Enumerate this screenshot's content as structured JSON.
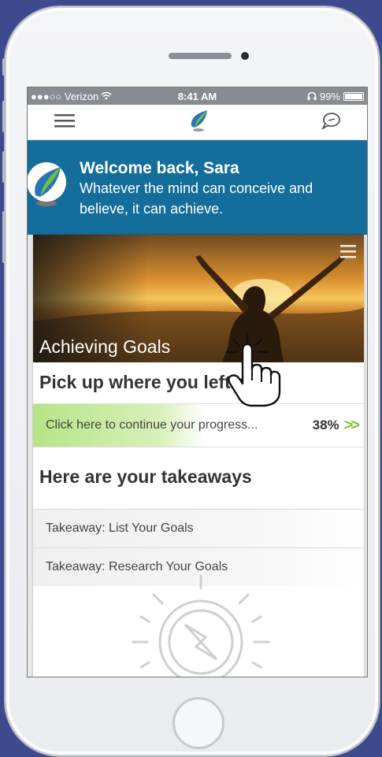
{
  "status": {
    "carrier": "●●●○○ Verizon",
    "time": "8:41 AM",
    "battery": "99%",
    "battery_level": 0.99
  },
  "navbar": {
    "menu_icon": "hamburger-menu-icon",
    "logo_icon": "app-leaf-logo-icon",
    "chat_icon": "chat-bubble-icon"
  },
  "welcome": {
    "title": "Welcome back, Sara",
    "quote": "Whatever the mind can conceive and believe, it can achieve."
  },
  "hero": {
    "label": "Achieving Goals"
  },
  "resume": {
    "title": "Pick up where you left off...",
    "link_text": "Click here to continue your progress...",
    "progress_percent": "38%",
    "progress_value": 0.38
  },
  "takeaways": {
    "title": "Here are your takeaways",
    "items": [
      "Takeaway: List Your Goals",
      "Takeaway: Research Your Goals"
    ]
  },
  "colors": {
    "brand_blue": "#146e9b",
    "accent_green": "#7cc63a",
    "background": "#3d4a8e"
  }
}
